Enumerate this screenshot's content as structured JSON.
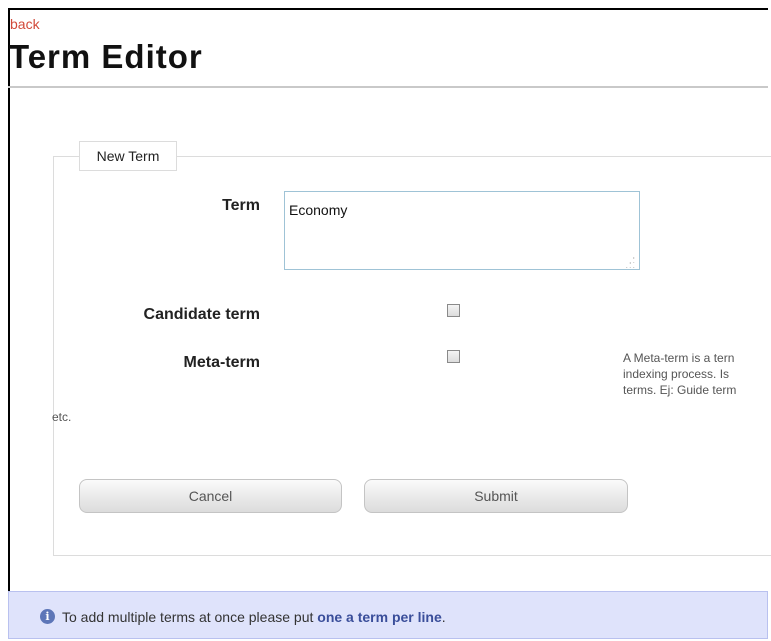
{
  "header": {
    "back_label": "back",
    "title": "Term Editor"
  },
  "form": {
    "legend": "New Term",
    "term": {
      "label": "Term",
      "value": "Economy"
    },
    "candidate": {
      "label": "Candidate term",
      "checked": false
    },
    "meta": {
      "label": "Meta-term",
      "checked": false,
      "help_line1": "A Meta-term is a tern",
      "help_line2": "indexing process. Is",
      "help_line3": "terms. Ej: Guide term",
      "help_etc": "etc."
    },
    "buttons": {
      "cancel": "Cancel",
      "submit": "Submit"
    }
  },
  "info": {
    "icon": "info-icon",
    "text_prefix": "To add multiple terms at once please put ",
    "text_emphasis": "one a term per line",
    "text_suffix": "."
  },
  "colors": {
    "back_link": "#d24a3a",
    "info_bg": "#dfe3fb",
    "info_emphasis": "#3a4e9a"
  }
}
